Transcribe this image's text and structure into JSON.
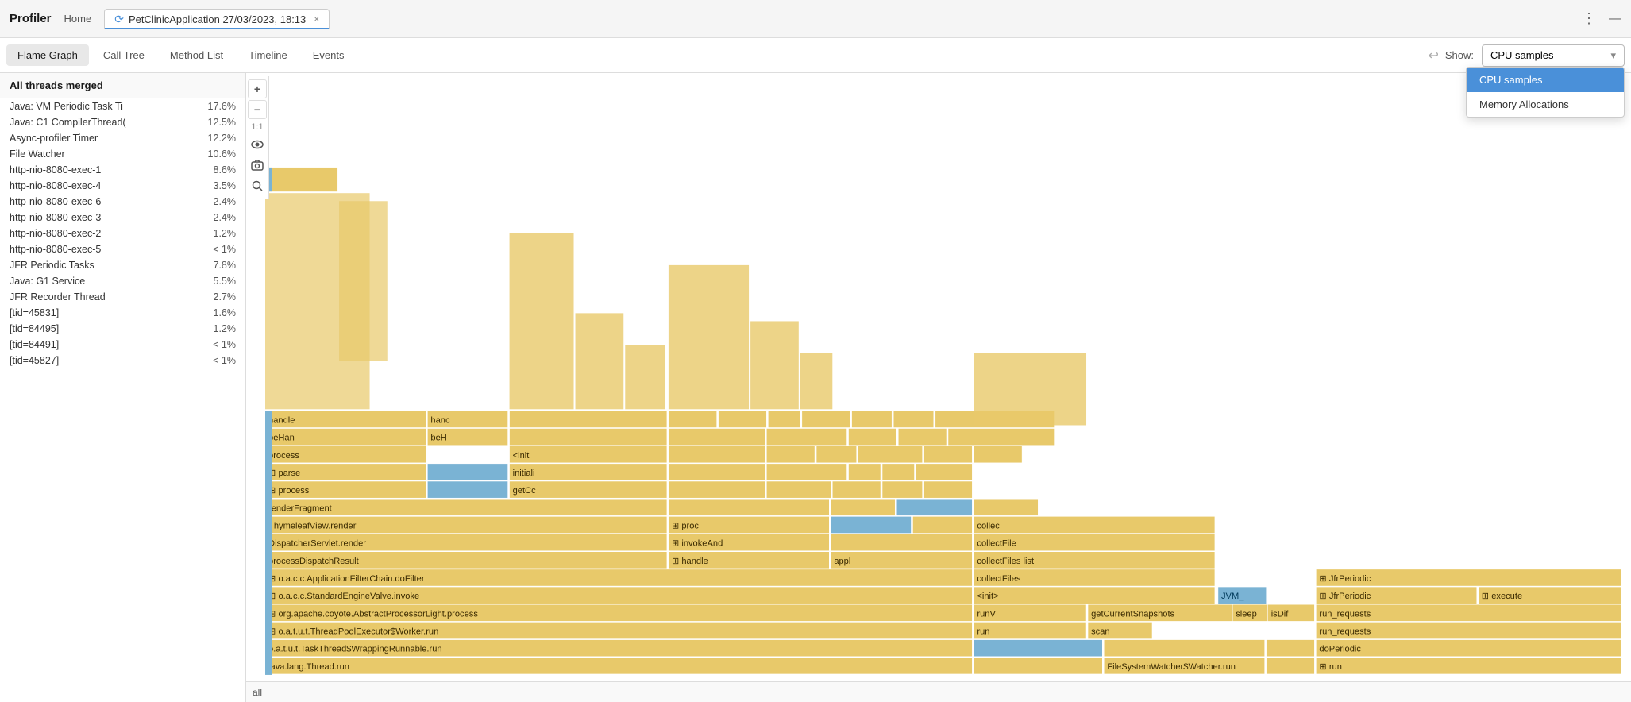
{
  "titleBar": {
    "appName": "Profiler",
    "homeLabel": "Home",
    "tabTitle": "PetClinicApplication 27/03/2023, 18:13",
    "closeLabel": "×",
    "dotsLabel": "⋮",
    "minimizeLabel": "—"
  },
  "tabs": {
    "views": [
      {
        "id": "flame-graph",
        "label": "Flame Graph",
        "active": true
      },
      {
        "id": "call-tree",
        "label": "Call Tree",
        "active": false
      },
      {
        "id": "method-list",
        "label": "Method List",
        "active": false
      },
      {
        "id": "timeline",
        "label": "Timeline",
        "active": false
      },
      {
        "id": "events",
        "label": "Events",
        "active": false
      }
    ],
    "showLabel": "Show:",
    "showDropdown": {
      "selected": "CPU samples",
      "options": [
        "CPU samples",
        "Memory Allocations"
      ]
    }
  },
  "sidebar": {
    "header": "All threads merged",
    "items": [
      {
        "name": "Java: VM Periodic Task Ti",
        "percent": "17.6%"
      },
      {
        "name": "Java: C1 CompilerThread(",
        "percent": "12.5%"
      },
      {
        "name": "Async-profiler Timer",
        "percent": "12.2%"
      },
      {
        "name": "File Watcher",
        "percent": "10.6%"
      },
      {
        "name": "http-nio-8080-exec-1",
        "percent": "8.6%"
      },
      {
        "name": "http-nio-8080-exec-4",
        "percent": "3.5%"
      },
      {
        "name": "http-nio-8080-exec-6",
        "percent": "2.4%"
      },
      {
        "name": "http-nio-8080-exec-3",
        "percent": "2.4%"
      },
      {
        "name": "http-nio-8080-exec-2",
        "percent": "1.2%"
      },
      {
        "name": "http-nio-8080-exec-5",
        "percent": "< 1%"
      },
      {
        "name": "JFR Periodic Tasks",
        "percent": "7.8%"
      },
      {
        "name": "Java: G1 Service",
        "percent": "5.5%"
      },
      {
        "name": "JFR Recorder Thread",
        "percent": "2.7%"
      },
      {
        "name": "[tid=45831]",
        "percent": "1.6%"
      },
      {
        "name": "[tid=84495]",
        "percent": "1.2%"
      },
      {
        "name": "[tid=84491]",
        "percent": "< 1%"
      },
      {
        "name": "[tid=45827]",
        "percent": "< 1%"
      }
    ]
  },
  "flameGraph": {
    "rows": [
      {
        "blocks": [
          {
            "label": "handle",
            "type": "yellow",
            "widthPct": 7
          },
          {
            "label": "hanc",
            "type": "yellow",
            "widthPct": 5
          },
          {
            "label": "",
            "type": "yellow",
            "widthPct": 14
          },
          {
            "label": "",
            "type": "yellow",
            "widthPct": 3
          },
          {
            "label": "",
            "type": "yellow",
            "widthPct": 2
          },
          {
            "label": "",
            "type": "yellow",
            "widthPct": 20
          },
          {
            "label": "",
            "type": "yellow",
            "widthPct": 4
          }
        ]
      }
    ],
    "bottomLabel": "all"
  },
  "controls": {
    "zoomIn": "+",
    "zoomOut": "−",
    "ratio": "1:1",
    "eye": "👁",
    "camera": "📷",
    "search": "🔍"
  },
  "dropdown": {
    "isOpen": true,
    "cpuSamples": "CPU samples",
    "memoryAllocations": "Memory Allocations"
  }
}
